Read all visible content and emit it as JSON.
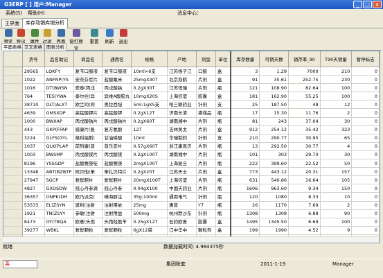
{
  "window": {
    "title": "G3ERP [ ] 用户:Manager"
  },
  "menu": {
    "system": "系统(S)",
    "help": "帮助(H)",
    "message_center": "消息中心："
  },
  "tabs": [
    {
      "label": "主界面"
    },
    {
      "label": "库存动销库销分析"
    }
  ],
  "toolbar": [
    {
      "label": "预览",
      "icon": "preview-icon",
      "color": "#3a6ea5"
    },
    {
      "label": "导出",
      "icon": "export-icon",
      "color": "#c8442c"
    },
    {
      "label": "属性",
      "icon": "properties-icon",
      "color": "#4a8c3a"
    },
    {
      "label": "过滤",
      "icon": "filter-icon",
      "color": "#c8a030"
    },
    {
      "label": "界面",
      "icon": "layout-icon",
      "color": "#3a6ea5"
    },
    {
      "label": "窗打预览",
      "icon": "print-preview-icon",
      "color": "#6a5aa0"
    },
    {
      "label": "重置",
      "icon": "reset-icon",
      "color": "#3a8c8c"
    },
    {
      "label": "刷新",
      "icon": "refresh-icon",
      "color": "#3a7ac8"
    },
    {
      "label": "退出",
      "icon": "exit-icon",
      "color": "#c83a3a"
    }
  ],
  "subtabs": [
    {
      "label": "平面表格"
    },
    {
      "label": "交叉表格"
    },
    {
      "label": "图表分析"
    }
  ],
  "table": {
    "headers": [
      "货号",
      "品名助记",
      "商品名",
      "通用名",
      "规格",
      "产地",
      "剂型",
      "单位",
      "库存数量",
      "可销天数",
      "销存率_90",
      "T90天销量",
      "暂停标志"
    ],
    "rows": [
      [
        "29565",
        "LQKFY",
        "复苄口服液",
        "复苄口服液",
        "10ml×6支",
        "江苏扬子江",
        "口服",
        "盒",
        "3",
        "1.29",
        "7000",
        "210",
        "0"
      ],
      [
        "1022",
        "ANFNP(YS",
        "安奈芬尼片",
        "盐酸氟米",
        "25mgX30T",
        "北京双鹤",
        "片剂",
        "盒",
        "91",
        "35.61",
        "252.75",
        "230",
        "0"
      ],
      [
        "1016",
        "DT(BWSN",
        "奔泰(丙戊",
        "丙戊酸钠",
        "0.2gX30T",
        "江苏恒瑞",
        "片剂",
        "瓶",
        "121",
        "108.90",
        "82.64",
        "100",
        "0"
      ],
      [
        "764",
        "TES(YWA",
        "泰尔丝(异",
        "异维A酸胶丸",
        "10mgX20S",
        "上海信谊",
        "胶囊",
        "盒",
        "181",
        "162.90",
        "55.25",
        "100",
        "0"
      ],
      [
        "38710",
        "OLT(ALXT",
        "欧兰同(阿",
        "奥拉西坦",
        "5ml:1gX5支",
        "哈三联药业",
        "针剂",
        "支",
        "25",
        "187.50",
        "48",
        "12",
        "0"
      ],
      [
        "4639",
        "GMSXDP",
        "高锰酸钾片",
        "高锰酸钾",
        "0.2gX12T",
        "济南长清",
        "搽煤品",
        "瓶",
        "17",
        "15.30",
        "11.76",
        "2",
        "0"
      ],
      [
        "1000",
        "BWXAP",
        "丙戊酸钠片",
        "丙戊酸钠片",
        "0.2gX60T",
        "湖南湘中",
        "片剂",
        "瓶",
        "81",
        "243",
        "37.04",
        "30",
        "0"
      ],
      [
        "443",
        "GKP(FFAP",
        "感康片(复",
        "复方氨酚",
        "12T",
        "吉林吴太",
        "片剂",
        "盒",
        "912",
        "254.12",
        "35.42",
        "323",
        "0"
      ],
      [
        "3224",
        "GLFS(GYL",
        "格利福斯(",
        "甘油磷酸",
        "10ml",
        "华瑞制药",
        "针剂",
        "支",
        "210",
        "290.77",
        "30.95",
        "65",
        "0"
      ],
      [
        "1037",
        "QLK(PLAP",
        "前列康(普",
        "普乐安片",
        "0.57gX60T",
        "浙江康恩贝",
        "片剂",
        "瓶",
        "13",
        "292.50",
        "30.77",
        "4",
        "0"
      ],
      [
        "1003",
        "BWSMP",
        "丙戊酸镁片",
        "丙戊酸镁",
        "0.2gX100T",
        "湖南湘中",
        "片剂",
        "瓶",
        "101",
        "303",
        "29.70",
        "30",
        "0"
      ],
      [
        "8196",
        "YSSGDP",
        "盐酸赛庚啶",
        "盐酸赛庚",
        "2mgX100T",
        "上海复旦",
        "片剂",
        "瓶",
        "222",
        "399.60",
        "22.52",
        "50",
        "0"
      ],
      [
        "13348",
        "ABT(BZBTP",
        "阿贝他(苯",
        "苯扎贝特片",
        "0.2gX20T",
        "江苏天士",
        "片剂",
        "盒",
        "773",
        "443.12",
        "20.31",
        "157",
        "0"
      ],
      [
        "27947",
        "SGCP",
        "复鲜胆片",
        "复鲜胆片",
        "20mgX100T",
        "上海信谊",
        "片剂",
        "瓶",
        "631",
        "540.86",
        "16.64",
        "105",
        "0"
      ],
      [
        "4827",
        "GXDSDW",
        "冠心丹参滴",
        "冠心丹参",
        "0.04gX100",
        "中国天药业",
        "片剂",
        "瓶",
        "1606",
        "963.60",
        "9.34",
        "150",
        "0"
      ],
      [
        "36357",
        "ONPK(DH",
        "欧乃派克(",
        "碘海醇注",
        "35g:100ml",
        "通用电气",
        "针剂",
        "瓶",
        "120",
        "1080",
        "8.33",
        "10",
        "0"
      ],
      [
        "53533",
        "EL(ZSYN",
        "恩利(注射",
        "注射用依",
        "25mg",
        "惠普",
        "Y7",
        "瓶",
        "26",
        "1170",
        "7.69",
        "2",
        "0"
      ],
      [
        "1921",
        "TN(ZSYY",
        "参敏(注射",
        "注射用益",
        "500mg",
        "杭州默沙东",
        "针剂",
        "瓶",
        "1308",
        "1308",
        "6.88",
        "90",
        "0"
      ],
      [
        "8473",
        "OY(TBQA",
        "欧意(头孢",
        "头孢羟氨苄",
        "0.25gX12T",
        "石药欧意",
        "胶囊",
        "盒",
        "1495",
        "1345.50",
        "6.69",
        "100",
        "0"
      ],
      [
        "39277",
        "WBKL",
        "复鲜颗粒",
        "复鲜颗粒",
        "6gX12袋",
        "江中华中",
        "颗粒剂",
        "盒",
        "199",
        "1990",
        "4.52",
        "9",
        "0"
      ],
      [
        "1007",
        "BBBTP",
        "苯巴比妥片",
        "苯巴比妥片",
        "30mgX100T",
        "上海信谊",
        "片剂",
        "瓶",
        "935",
        "2103.75",
        "4.28",
        "40",
        "0"
      ],
      [
        "2682",
        "EFS(BSLB",
        "恩氟烷(苯",
        "苯磺酸氨",
        "2mg:10g",
        "广东顺峰",
        "片剂",
        "盒",
        "307",
        "2763",
        "3.26",
        "10",
        "0"
      ],
      [
        "1587",
        "HTZZW",
        "华佗再造丸",
        "华佗再造丸",
        "80g",
        "广州奇星",
        "丸剂",
        "盒",
        "17930",
        "2960.92",
        "3.04",
        "545",
        "0"
      ]
    ]
  },
  "status": {
    "ready": "就绪",
    "load_time": "数据加载时间: 4.984375秒"
  },
  "taskbar": {
    "company": "集团账套",
    "date": "2011-1-19",
    "user": "Manager",
    "ime": "英"
  }
}
